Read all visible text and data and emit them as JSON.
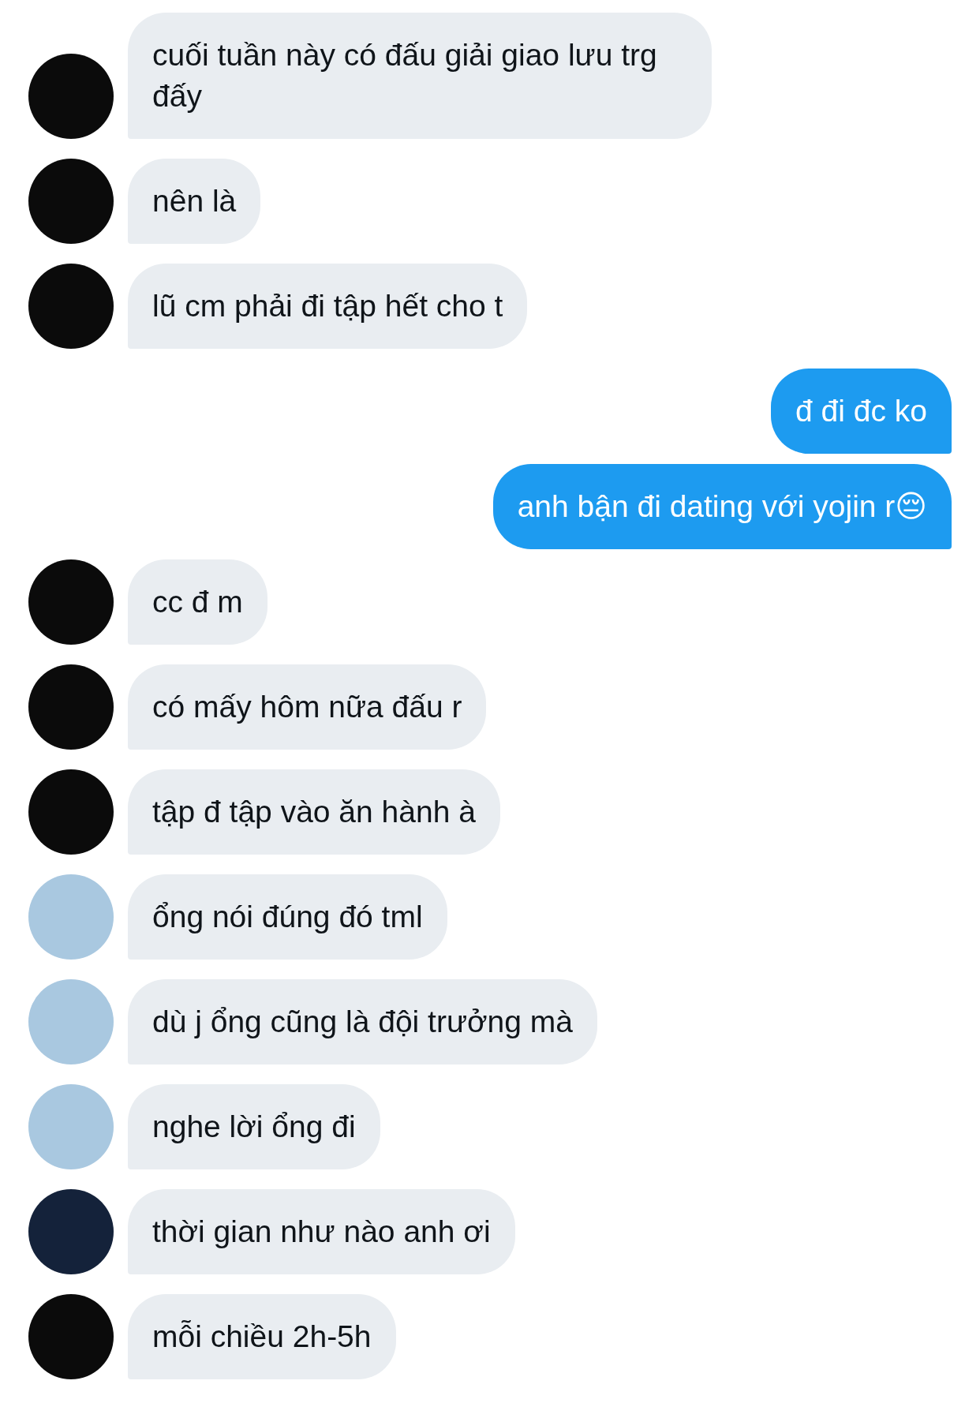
{
  "messages": [
    {
      "kind": "received",
      "color": "#0b0b0b",
      "text": "cuối tuần này có đấu giải giao lưu trg đấy"
    },
    {
      "kind": "received",
      "color": "#0b0b0b",
      "text": "nên là"
    },
    {
      "kind": "received",
      "color": "#0b0b0b",
      "text": "lũ cm phải đi tập hết cho t"
    },
    {
      "kind": "sent",
      "text": "đ đi đc ko"
    },
    {
      "kind": "sent",
      "text": "anh bận đi dating với yojin r😔"
    },
    {
      "kind": "received",
      "color": "#0b0b0b",
      "text": "cc đ m"
    },
    {
      "kind": "received",
      "color": "#0b0b0b",
      "text": "có mấy hôm nữa đấu r"
    },
    {
      "kind": "received",
      "color": "#0b0b0b",
      "text": "tập đ tập vào ăn hành à"
    },
    {
      "kind": "received",
      "color": "#a9c8e0",
      "text": "ổng nói đúng đó tml"
    },
    {
      "kind": "received",
      "color": "#a9c8e0",
      "text": "dù j ổng cũng là đội trưởng mà"
    },
    {
      "kind": "received",
      "color": "#a9c8e0",
      "text": "nghe lời ổng đi"
    },
    {
      "kind": "received",
      "color": "#14223a",
      "text": "thời gian như nào anh ơi"
    },
    {
      "kind": "received",
      "color": "#0b0b0b",
      "text": "mỗi chiều 2h-5h"
    }
  ]
}
